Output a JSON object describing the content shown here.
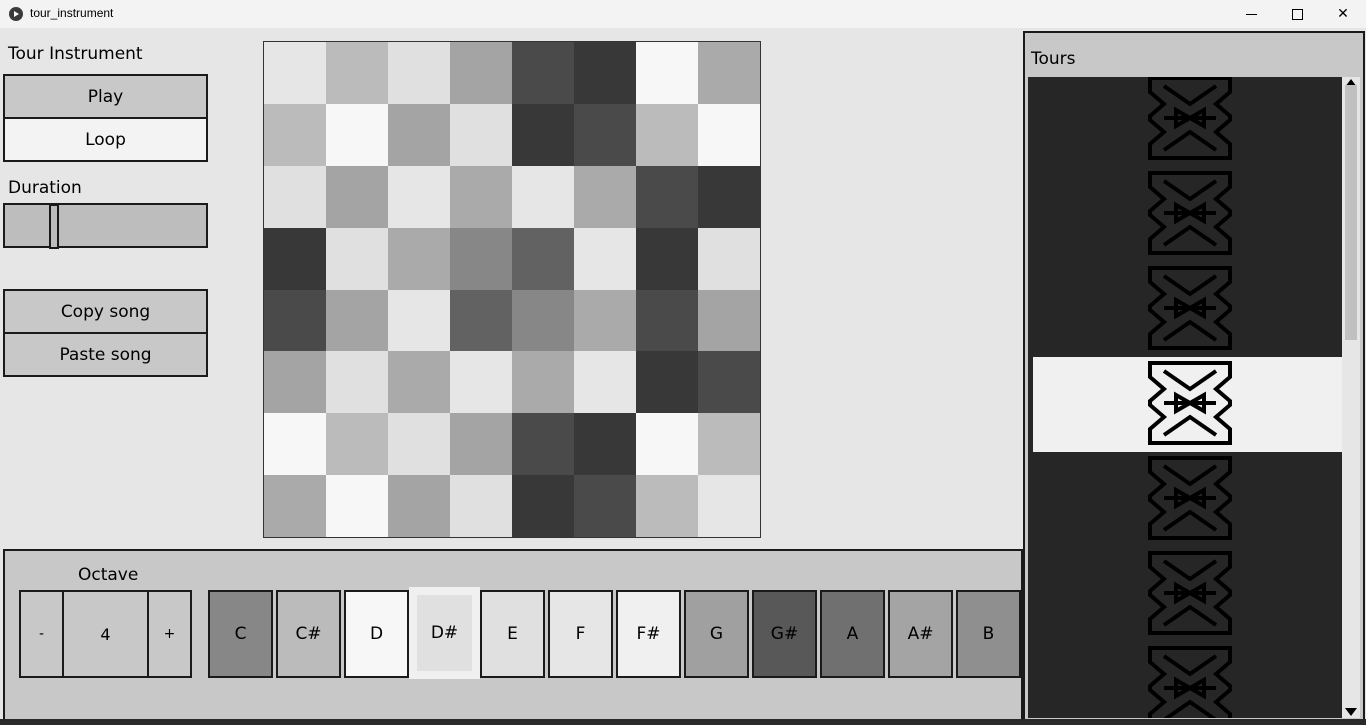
{
  "window": {
    "title": "tour_instrument",
    "minimize_icon": "minimize-icon",
    "maximize_icon": "maximize-icon",
    "close_icon": "close-icon"
  },
  "left": {
    "heading": "Tour Instrument",
    "play_label": "Play",
    "loop_label": "Loop",
    "duration_label": "Duration",
    "duration_value": 0.23,
    "copy_label": "Copy song",
    "paste_label": "Paste song"
  },
  "grid": {
    "colors": [
      [
        "#e6e6e6",
        "#bbbbbb",
        "#e0e0e0",
        "#a4a4a4",
        "#4a4a4a",
        "#383838",
        "#f7f7f7",
        "#aaaaaa"
      ],
      [
        "#bbbbbb",
        "#f7f7f7",
        "#a4a4a4",
        "#e0e0e0",
        "#383838",
        "#4a4a4a",
        "#bbbbbb",
        "#f7f7f7"
      ],
      [
        "#e0e0e0",
        "#a4a4a4",
        "#e6e6e6",
        "#aaaaaa",
        "#e6e6e6",
        "#aaaaaa",
        "#4a4a4a",
        "#383838"
      ],
      [
        "#383838",
        "#e0e0e0",
        "#aaaaaa",
        "#878787",
        "#626262",
        "#e6e6e6",
        "#383838",
        "#e0e0e0"
      ],
      [
        "#4a4a4a",
        "#a4a4a4",
        "#e6e6e6",
        "#626262",
        "#878787",
        "#aaaaaa",
        "#4a4a4a",
        "#a4a4a4"
      ],
      [
        "#a4a4a4",
        "#e0e0e0",
        "#aaaaaa",
        "#e6e6e6",
        "#aaaaaa",
        "#e6e6e6",
        "#383838",
        "#4a4a4a"
      ],
      [
        "#f7f7f7",
        "#bbbbbb",
        "#e0e0e0",
        "#a4a4a4",
        "#4a4a4a",
        "#383838",
        "#f7f7f7",
        "#bbbbbb"
      ],
      [
        "#aaaaaa",
        "#f7f7f7",
        "#a4a4a4",
        "#e0e0e0",
        "#383838",
        "#4a4a4a",
        "#bbbbbb",
        "#e6e6e6"
      ]
    ]
  },
  "keyboard": {
    "octave_label": "Octave",
    "octave_minus": "-",
    "octave_value": "4",
    "octave_plus": "+",
    "keys": [
      {
        "name": "C",
        "color": "#878787"
      },
      {
        "name": "C#",
        "color": "#bbbbbb"
      },
      {
        "name": "D",
        "color": "#f7f7f7"
      },
      {
        "name": "D#",
        "color": "#e0e0e0",
        "selected": true
      },
      {
        "name": "E",
        "color": "#e0e0e0"
      },
      {
        "name": "F",
        "color": "#e6e6e6"
      },
      {
        "name": "F#",
        "color": "#f0f0f0"
      },
      {
        "name": "G",
        "color": "#a0a0a0"
      },
      {
        "name": "G#",
        "color": "#585858"
      },
      {
        "name": "A",
        "color": "#707070"
      },
      {
        "name": "A#",
        "color": "#a4a4a4"
      },
      {
        "name": "B",
        "color": "#8f8f8f"
      }
    ]
  },
  "tours": {
    "title": "Tours",
    "count_visible": 7,
    "selected_index": 3
  }
}
